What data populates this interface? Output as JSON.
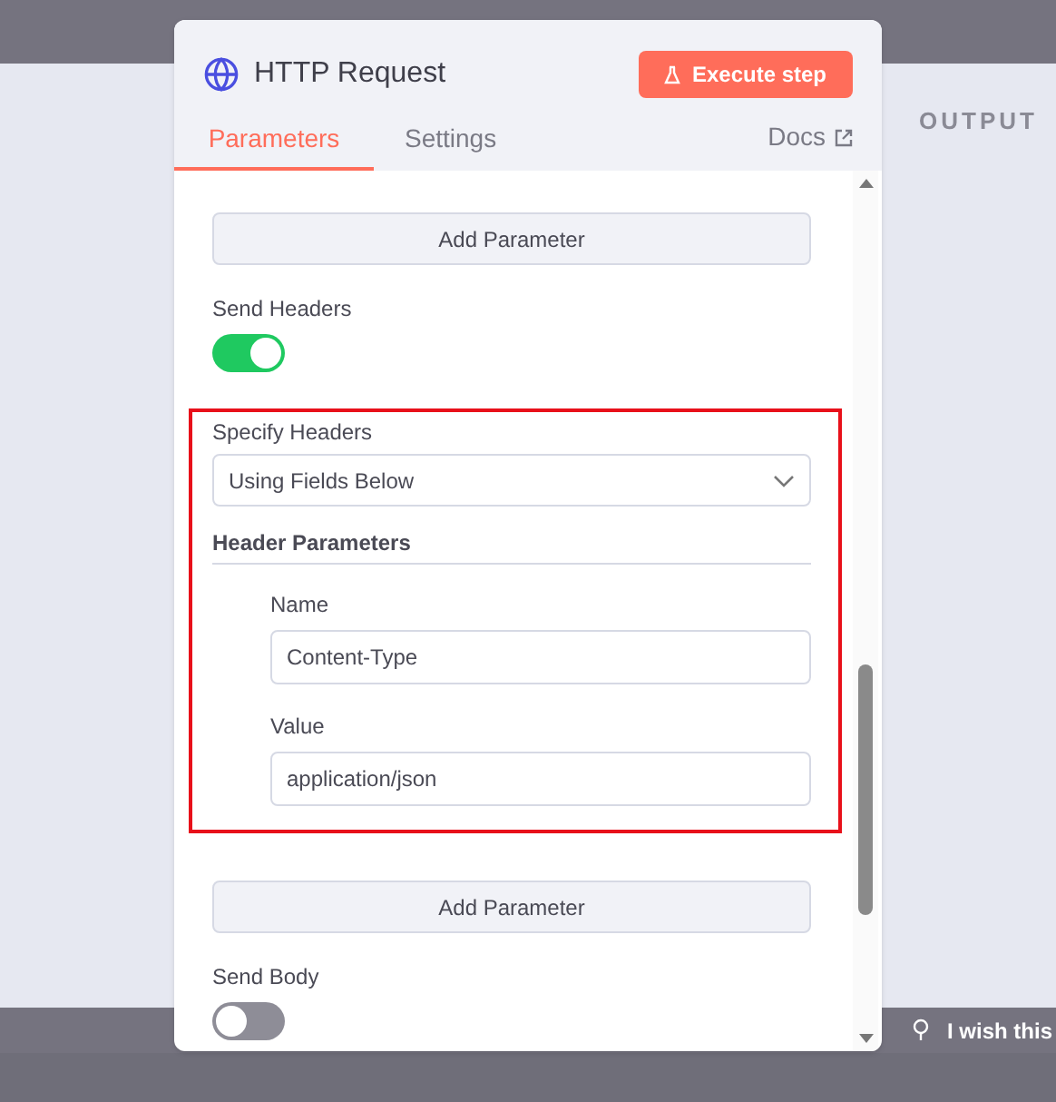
{
  "background": {
    "panel_label": "OUTPUT",
    "feedback": "I wish this"
  },
  "node": {
    "title": "HTTP Request",
    "execute_button": "Execute step",
    "docs_link": "Docs",
    "tabs": [
      {
        "label": "Parameters",
        "selected": true
      },
      {
        "label": "Settings",
        "selected": false
      }
    ]
  },
  "sections": [
    {
      "kind": "button",
      "label": "Add Parameter"
    },
    {
      "kind": "toggle",
      "label": "Send Headers",
      "on": true
    },
    {
      "kind": "header_block",
      "highlighted": true,
      "select_label": "Specify Headers",
      "select_value": "Using Fields Below",
      "title": "Header Parameters",
      "parameters": [
        {
          "label": "Name",
          "value": "Content-Type"
        },
        {
          "label": "Value",
          "value": "application/json"
        }
      ]
    },
    {
      "kind": "button",
      "label": "Add Parameter"
    },
    {
      "kind": "toggle",
      "label": "Send Body",
      "on": false
    }
  ]
}
